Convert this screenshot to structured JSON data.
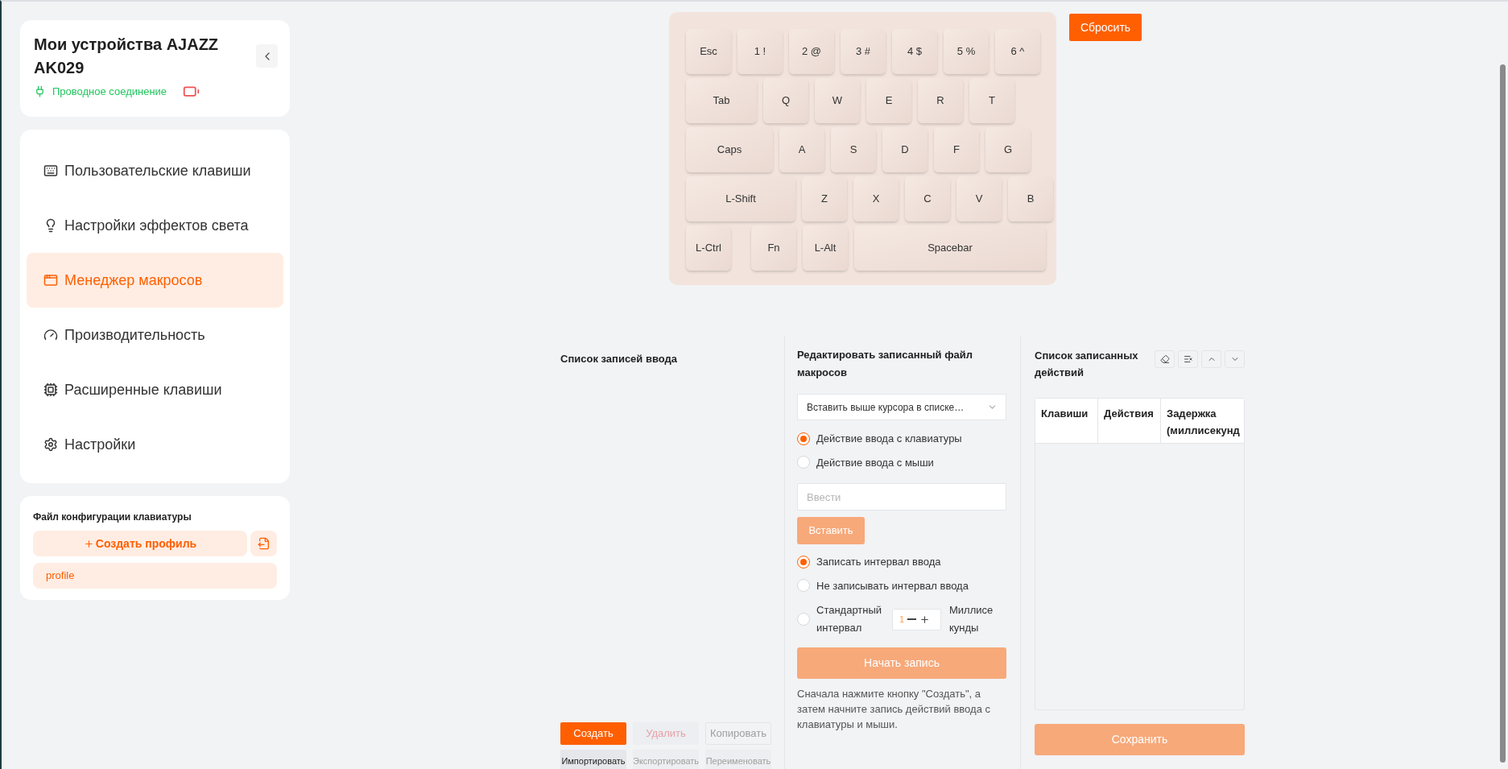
{
  "device": {
    "title": "Мои устройства AJAZZ AK029",
    "connection": "Проводное соединение"
  },
  "nav": {
    "items": [
      {
        "label": "Пользовательские клавиши",
        "kind": "keys",
        "selected": false
      },
      {
        "label": "Настройки эффектов света",
        "kind": "light",
        "selected": false
      },
      {
        "label": "Менеджер макросов",
        "kind": "macro",
        "selected": true
      },
      {
        "label": "Производительность",
        "kind": "performance",
        "selected": false
      },
      {
        "label": "Расширенные клавиши",
        "kind": "advanced",
        "selected": false
      },
      {
        "label": "Настройки",
        "kind": "settings",
        "selected": false
      }
    ]
  },
  "profiles": {
    "title": "Файл конфигурации клавиатуры",
    "create_label": "Создать профиль",
    "items": [
      {
        "label": "profile",
        "selected": true
      }
    ]
  },
  "keyboard": {
    "rows": [
      [
        "Esc",
        "1 !",
        "2 @",
        "3 #",
        "4 $",
        "5 %",
        "6 ^"
      ],
      [
        "Tab",
        "Q",
        "W",
        "E",
        "R",
        "T"
      ],
      [
        "Caps",
        "A",
        "S",
        "D",
        "F",
        "G"
      ],
      [
        "L-Shift",
        "Z",
        "X",
        "C",
        "V",
        "B"
      ],
      [
        "L-Ctrl",
        "Fn",
        "L-Alt",
        "Spacebar"
      ]
    ]
  },
  "reset_button": "Сбросить",
  "records": {
    "title": "Список записей ввода",
    "buttons": [
      {
        "label": "Создать",
        "kind": "primary",
        "disabled": false
      },
      {
        "label": "Удалить",
        "kind": "danger",
        "disabled": true
      },
      {
        "label": "Копировать",
        "kind": "outline",
        "disabled": true
      },
      {
        "label": "Импортировать",
        "kind": "default",
        "disabled": false
      },
      {
        "label": "Экспортировать",
        "kind": "default",
        "disabled": true
      },
      {
        "label": "Переименовать",
        "kind": "default",
        "disabled": true
      }
    ]
  },
  "editor": {
    "title": "Редактировать записанный файл макросов",
    "insert_mode": "Вставить выше курсора в списке…",
    "input_types": [
      {
        "label": "Действие ввода с клавиатуры",
        "selected": true
      },
      {
        "label": "Действие ввода с мыши",
        "selected": false
      }
    ],
    "input_placeholder": "Ввести",
    "insert_button": {
      "label": "Вставить",
      "disabled": true
    },
    "interval_options": [
      {
        "label": "Записать интервал ввода",
        "kind": "plain",
        "selected": true
      },
      {
        "label": "Не записывать интервал ввода",
        "kind": "plain",
        "selected": false
      },
      {
        "label": "Стандартный интервал",
        "kind": "stepper",
        "selected": false,
        "value": "1",
        "unit": "Миллисекунды"
      }
    ],
    "start_button": {
      "label": "Начать запись",
      "disabled": true
    },
    "hint": "Сначала нажмите кнопку \"Создать\", а затем начните запись действий ввода с клавиатуры и мыши."
  },
  "actions": {
    "title": "Список записанных действий",
    "columns": [
      "Клавиши",
      "Действия",
      "Задержка (миллисекунд"
    ],
    "save_button": {
      "label": "Сохранить",
      "disabled": true
    }
  }
}
